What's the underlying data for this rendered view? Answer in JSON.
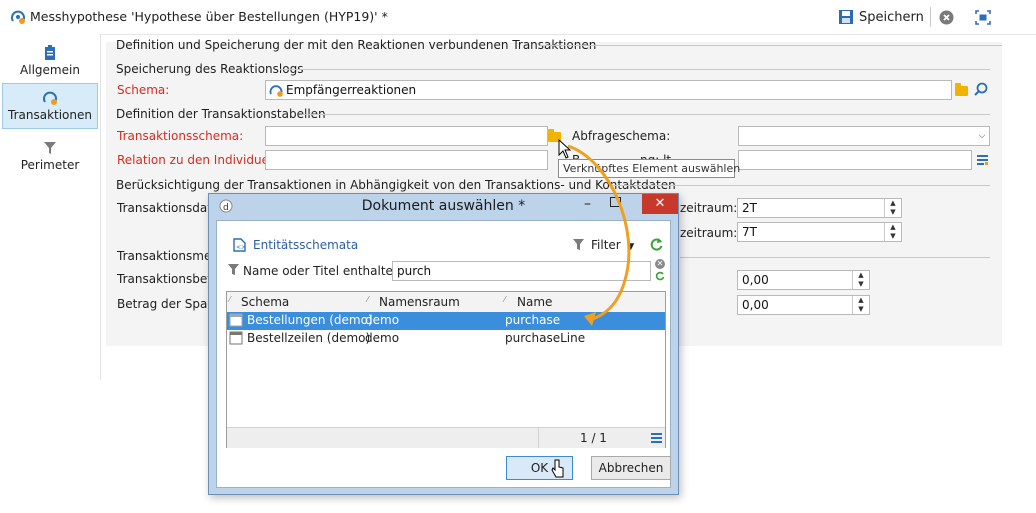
{
  "window": {
    "title": "Messhypothese 'Hypothese über Bestellungen (HYP19)' *",
    "save_label": "Speichern"
  },
  "sidebar": {
    "items": [
      {
        "label": "Allgemein"
      },
      {
        "label": "Transaktionen"
      },
      {
        "label": "Perimeter"
      }
    ]
  },
  "form": {
    "section_definition": "Definition und Speicherung der mit den Reaktionen verbundenen Transaktionen",
    "section_storage": "Speicherung des Reaktionslogs",
    "schema_label": "Schema:",
    "schema_value": "Empfängerreaktionen",
    "section_tables": "Definition der Transaktionstabellen",
    "transaction_schema_label": "Transaktionsschema:",
    "transaction_schema_value": "",
    "query_schema_label": "Abfrageschema:",
    "query_schema_value": "",
    "relation_label": "Relation zu den Individuen:",
    "relation_value": "",
    "behind_tooltip_label": "B",
    "behind_tooltip_label2": "ng:     lt",
    "section_consideration": "Berücksichtigung der Transaktionen in Abhängigkeit von den Transaktions- und Kontaktdaten",
    "transaction_date_label": "Transaktionsdatu",
    "period1_label": "zeitraum:",
    "period1_value": "2T",
    "period2_label": "zeitraum:",
    "period2_value": "7T",
    "transaction_measure_label": "Transaktionsmess",
    "transaction_amount_label": "Transaktionsbetra",
    "amount1_value": "0,00",
    "spread_label": "Betrag der Spanne",
    "amount2_value": "0,00"
  },
  "tooltip": {
    "text": "Verknüpftes Element auswählen"
  },
  "dialog": {
    "title": "Dokument auswählen *",
    "folder_label": "Entitätsschemata",
    "filter_label": "Filter",
    "search_label": "Name oder Titel enthalten:",
    "search_value": "purch",
    "columns": [
      "Schema",
      "Namensraum",
      "Name"
    ],
    "rows": [
      {
        "schema": "Bestellungen (demo)",
        "namespace": "demo",
        "name": "purchase",
        "selected": true
      },
      {
        "schema": "Bestellzeilen (demo)",
        "namespace": "demo",
        "name": "purchaseLine",
        "selected": false
      }
    ],
    "pagination": "1 / 1",
    "ok_label": "OK",
    "cancel_label": "Abbrechen"
  },
  "colors": {
    "accent": "#3b8edb",
    "required_label": "#d62b1f",
    "dialog_frame": "#bcd3e9",
    "annotation_arrow": "#f0a020"
  }
}
